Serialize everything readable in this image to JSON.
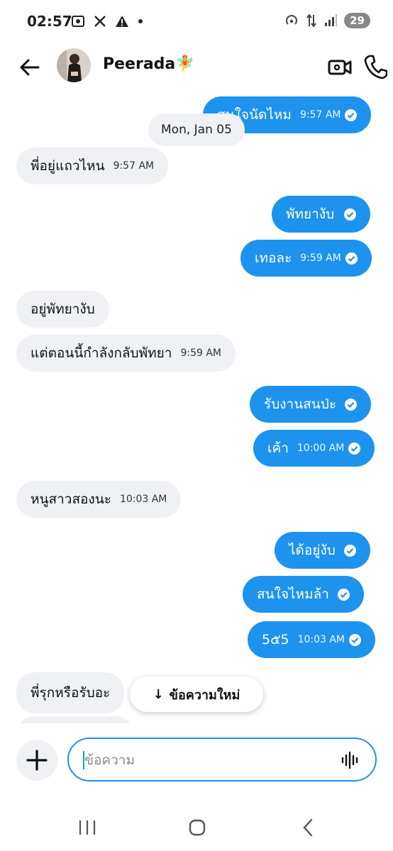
{
  "status_bar": {
    "time": "02:57",
    "left_icons": [
      "screen-record-icon",
      "x-logo-icon",
      "warning-icon",
      "dot-icon"
    ],
    "right_icons": [
      "hotspot-icon",
      "data-arrows-icon",
      "signal-icon"
    ],
    "battery": "29"
  },
  "header": {
    "contact_name": "Peerada",
    "name_emoji": "🧚",
    "back_icon": "arrow-left-icon",
    "video_icon": "video-call-icon",
    "call_icon": "phone-icon"
  },
  "chat": {
    "date_separator": "Mon, Jan 05",
    "messages": [
      {
        "dir": "out",
        "text": "สนใจนัดไหม",
        "time": "9:57 AM",
        "read": true
      },
      {
        "dir": "in",
        "text": "พี่อยู่แถวไหน",
        "time": "9:57 AM"
      },
      {
        "dir": "out",
        "text": "พัทยางับ",
        "time": "",
        "read": true
      },
      {
        "dir": "out",
        "text": "เทอละ",
        "time": "9:59 AM",
        "read": true
      },
      {
        "dir": "in",
        "text": "อยู่พัทยางับ",
        "time": ""
      },
      {
        "dir": "in",
        "text": "แต่ตอนนี้กำลังกลับพัทยา",
        "time": "9:59 AM"
      },
      {
        "dir": "out",
        "text": "รับงานสนป่ะ",
        "time": "",
        "read": true
      },
      {
        "dir": "out",
        "text": "เค้า",
        "time": "10:00 AM",
        "read": true
      },
      {
        "dir": "in",
        "text": "หนูสาวสองนะ",
        "time": "10:03 AM"
      },
      {
        "dir": "out",
        "text": "ได้อยู่งับ",
        "time": "",
        "read": true
      },
      {
        "dir": "out",
        "text": "สนใจไหมล้า",
        "time": "",
        "read": true
      },
      {
        "dir": "out",
        "text": "5๕5",
        "time": "10:03 AM",
        "read": true
      },
      {
        "dir": "in",
        "text": "พี่รุกหรือรับอะ",
        "time": ""
      }
    ],
    "new_messages_button": "ข้อความใหม่"
  },
  "composer": {
    "placeholder": "ข้อความ",
    "plus_icon": "plus-icon",
    "voice_icon": "voice-waveform-icon"
  },
  "nav": {
    "icons": [
      "recent-apps-icon",
      "home-icon",
      "back-icon"
    ]
  },
  "colors": {
    "outgoing_bubble": "#1d93ee",
    "incoming_bubble": "#eff1f4",
    "accent": "#1d93ee"
  }
}
